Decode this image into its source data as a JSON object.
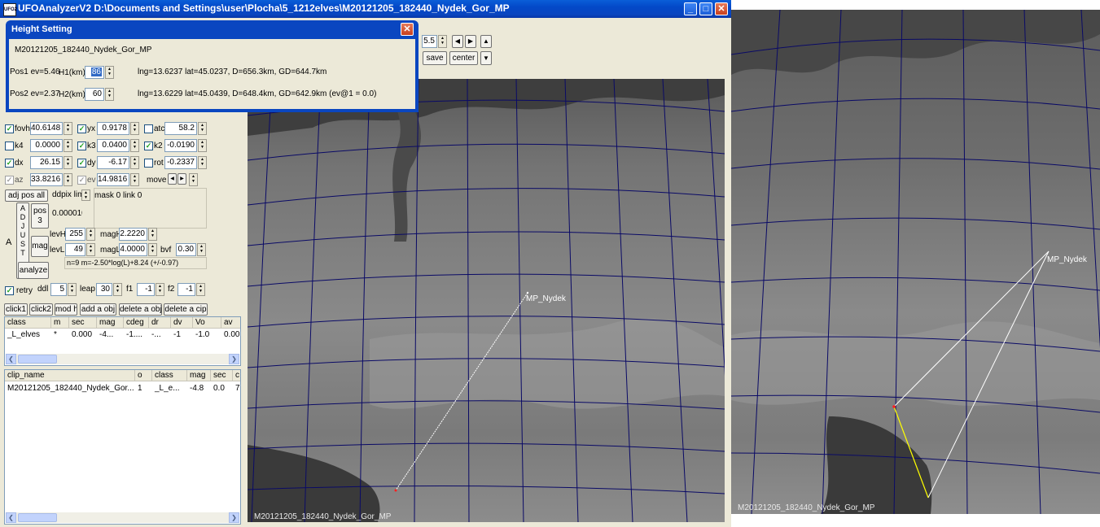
{
  "window": {
    "title": "UFOAnalyzerV2 D:\\Documents and Settings\\user\\Plocha\\5_1212elves\\M20121205_182440_Nydek_Gor_MP",
    "icon_text": "UFO2",
    "minimize": "_",
    "maximize": "□",
    "close": "✕"
  },
  "toolbar": {
    "zoom_value": "5.5",
    "save_label": "save",
    "center_label": "center",
    "arrow_left": "◀",
    "arrow_right": "▶",
    "arrow_up": "▲",
    "arrow_down": "▼"
  },
  "height_dialog": {
    "title": "Height Setting",
    "clip": "M20121205_182440_Nydek_Gor_MP",
    "pos1_label": "Pos1 ev=5.46",
    "h1_label": "H1(km)",
    "h1_value": "86",
    "pos1_info": "lng=13.6237 lat=45.0237, D=656.3km, GD=644.7km",
    "pos2_label": "Pos2 ev=2.37",
    "h2_label": "H2(km)",
    "h2_value": "60",
    "pos2_info": "lng=13.6229 lat=45.0439, D=648.4km, GD=642.9km  (ev@1 = 0.0)"
  },
  "params": {
    "fovh_label": "fovh",
    "fovh_value": "40.6148",
    "yx_label": "yx",
    "yx_value": "0.9178",
    "atc_label": "atc",
    "atc_value": "58.2",
    "k4_label": "k4",
    "k4_value": "0.0000",
    "k3_label": "k3",
    "k3_value": "0.0400",
    "k2_label": "k2",
    "k2_value": "-0.0190",
    "dx_label": "dx",
    "dx_value": "26.15",
    "dy_label": "dy",
    "dy_value": "-6.17",
    "rot_label": "rot",
    "rot_value": "-0.2337",
    "az_label": "az",
    "az_value": "33.8216",
    "ev_label": "ev",
    "ev_value": "14.9816",
    "move_label": "move"
  },
  "adjust": {
    "adj_pos_all": "adj pos all",
    "ddpix_label": "ddpix lim",
    "mask_label": "mask 0",
    "link_label": "link 0",
    "a_label": "A",
    "adjust_letters": [
      "A",
      "D",
      "J",
      "U",
      "S",
      "T"
    ],
    "pos_button": "pos\n3",
    "ddpix_value": "0.000010",
    "mag_button": "mag",
    "analyze_button": "analyze"
  },
  "levels": {
    "levh_label": "levH",
    "levh_value": "255",
    "levl_label": "levL",
    "levl_value": "49",
    "magh_label": "magH",
    "magh_value": "2.2220",
    "magl_label": "magL",
    "magl_value": "4.0000",
    "bvf_label": "bvf",
    "bvf_value": "0.30",
    "formula": "n=9 m=-2.50*log(L)+8.24 (+/-0.97)"
  },
  "retry_row": {
    "retry_label": "retry",
    "ddl_label": "ddl",
    "ddl_value": "5",
    "leap_label": "leap",
    "leap_value": "30",
    "f1_label": "f1",
    "f1_value": "-1",
    "f2_label": "f2",
    "f2_value": "-1"
  },
  "action_buttons": {
    "click1": "click1",
    "click2": "click2",
    "mod_h": "mod h",
    "add_obj": "add a obj",
    "delete_obj": "delete a obj",
    "delete_clip": "delete a cip"
  },
  "object_table": {
    "headers": [
      "class",
      "m",
      "sec",
      "mag",
      "cdeg",
      "dr",
      "dv",
      "Vo",
      "av"
    ],
    "rows": [
      [
        "_L_elves",
        "*",
        "0.000",
        "-4...",
        "-1....",
        "-...",
        "-1",
        "-1.0",
        "0.00"
      ]
    ]
  },
  "clip_table": {
    "headers": [
      "clip_name",
      "o",
      "class",
      "mag",
      "sec",
      "c"
    ],
    "rows": [
      [
        "M20121205_182440_Nydek_Gor...",
        "1",
        "_L_e...",
        "-4.8",
        "0.0",
        "7"
      ]
    ]
  },
  "map_main": {
    "caption": "M20121205_182440_Nydek_Gor_MP",
    "station_label": "MP_Nydek"
  },
  "map_right": {
    "caption": "M20121205_182440_Nydek_Gor_MP",
    "station_label": "MP_Nydek"
  },
  "colors": {
    "grid": "#0a0a66",
    "track": "#ffffff",
    "projection": "#ffff00",
    "event_point": "#ff2020"
  }
}
